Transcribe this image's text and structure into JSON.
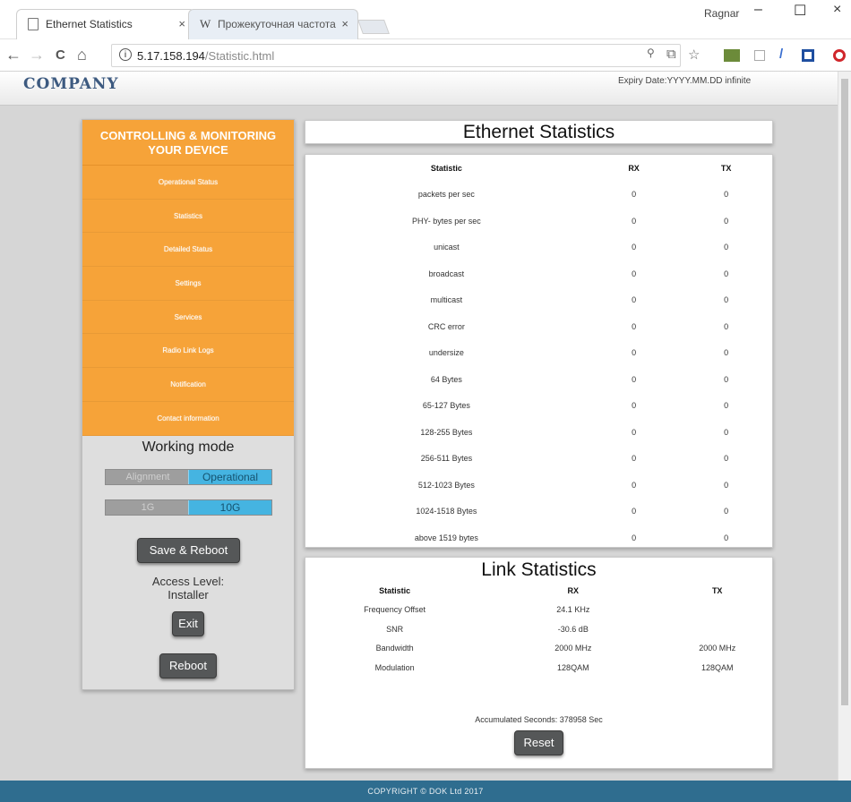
{
  "browser": {
    "tabs": [
      {
        "label": "Ethernet Statistics",
        "close": "×"
      },
      {
        "label": "Прожекуточная частота",
        "close": "×"
      }
    ],
    "profile": "Ragnar",
    "window_controls": {
      "minimize": "–",
      "maximize": "☐",
      "close": "×"
    },
    "nav": {
      "back": "←",
      "forward": "→",
      "reload": "C",
      "home": "⌂"
    },
    "url": {
      "host": "5.17.158.194",
      "path": "/Statistic.html",
      "info": "i"
    },
    "toolbar_icons": {
      "zoom": "🔍",
      "translate": "⧉",
      "star": "☆"
    }
  },
  "header": {
    "logo": "COMPANY",
    "expiry": "Expiry Date:YYYY.MM.DD infinite"
  },
  "sidebar": {
    "title_line1": "CONTROLLING & MONITORING",
    "title_line2": "YOUR DEVICE",
    "items": [
      {
        "label": "Operational Status"
      },
      {
        "label": "Statistics"
      },
      {
        "label": "Detailed Status"
      },
      {
        "label": "Settings"
      },
      {
        "label": "Services"
      },
      {
        "label": "Radio Link Logs"
      },
      {
        "label": "Notification"
      },
      {
        "label": "Contact information"
      }
    ],
    "working_mode_title": "Working mode",
    "mode_toggle": {
      "off": "Alignment",
      "on": "Operational"
    },
    "speed_toggle": {
      "off": "1G",
      "on": "10G"
    },
    "save_reboot": "Save & Reboot",
    "access_level_label": "Access Level:",
    "access_level_value": "Installer",
    "exit": "Exit",
    "reboot": "Reboot"
  },
  "ethernet": {
    "title": "Ethernet Statistics",
    "columns": [
      "Statistic",
      "RX",
      "TX"
    ],
    "rows": [
      [
        "packets per sec",
        "0",
        "0"
      ],
      [
        "PHY- bytes per sec",
        "0",
        "0"
      ],
      [
        "unicast",
        "0",
        "0"
      ],
      [
        "broadcast",
        "0",
        "0"
      ],
      [
        "multicast",
        "0",
        "0"
      ],
      [
        "CRC error",
        "0",
        "0"
      ],
      [
        "undersize",
        "0",
        "0"
      ],
      [
        "64 Bytes",
        "0",
        "0"
      ],
      [
        "65-127 Bytes",
        "0",
        "0"
      ],
      [
        "128-255 Bytes",
        "0",
        "0"
      ],
      [
        "256-511 Bytes",
        "0",
        "0"
      ],
      [
        "512-1023 Bytes",
        "0",
        "0"
      ],
      [
        "1024-1518 Bytes",
        "0",
        "0"
      ],
      [
        "above 1519 bytes",
        "0",
        "0"
      ]
    ]
  },
  "link": {
    "title": "Link Statistics",
    "columns": [
      "Statistic",
      "RX",
      "TX"
    ],
    "rows": [
      [
        "Frequency Offset",
        "24.1 KHz",
        ""
      ],
      [
        "SNR",
        "-30.6 dB",
        ""
      ],
      [
        "Bandwidth",
        "2000 MHz",
        "2000 MHz"
      ],
      [
        "Modulation",
        "128QAM",
        "128QAM"
      ]
    ],
    "accumulated": "Accumulated Seconds: 378958 Sec",
    "reset": "Reset"
  },
  "footer": {
    "text": "COPYRIGHT © DOK Ltd 2017"
  },
  "colors": {
    "accent_orange": "#f6a339",
    "toggle_blue": "#45b4e1",
    "footer": "#2f6d8f"
  }
}
